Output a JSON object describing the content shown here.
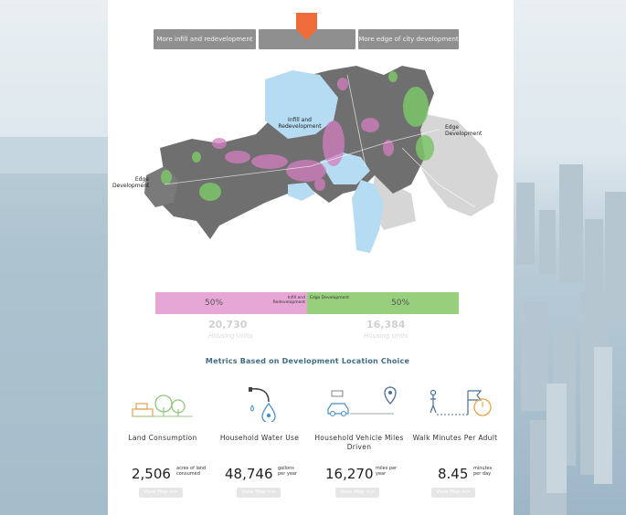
{
  "slider": {
    "left_label": "More infill and redevelopment",
    "middle_label": "",
    "right_label": "More edge of city development"
  },
  "map": {
    "label_infill": "Infill and Redevelopment",
    "label_edge_right": "Edge Development",
    "label_edge_left": "Edge Development"
  },
  "split": {
    "left_pct": "50%",
    "left_small": "Infill and Redevelopment",
    "right_small": "Edge Development",
    "right_pct": "50%",
    "left_color": "#e6a7d6",
    "right_color": "#98cf7d",
    "left_units": "20,730",
    "left_units_label": "Housing Units",
    "right_units": "16,384",
    "right_units_label": "Housing Units"
  },
  "metrics_title": "Metrics Based on Development Location Choice",
  "metrics": [
    {
      "icon": "trees-icon",
      "label": "Land Consumption",
      "value": "2,506",
      "unit": "acres of land consumed",
      "button": "View Map >>"
    },
    {
      "icon": "faucet-drop-icon",
      "label": "Household Water Use",
      "value": "48,746",
      "unit": "gallons per year",
      "button": "View Map >>"
    },
    {
      "icon": "car-route-icon",
      "label": "Household Vehicle Miles Driven",
      "value": "16,270",
      "unit": "miles per year",
      "button": "View Map >>"
    },
    {
      "icon": "walk-timer-icon",
      "label": "Walk Minutes Per Adult",
      "value": "8.45",
      "unit": "minutes per day",
      "button": "View Map >>"
    }
  ]
}
